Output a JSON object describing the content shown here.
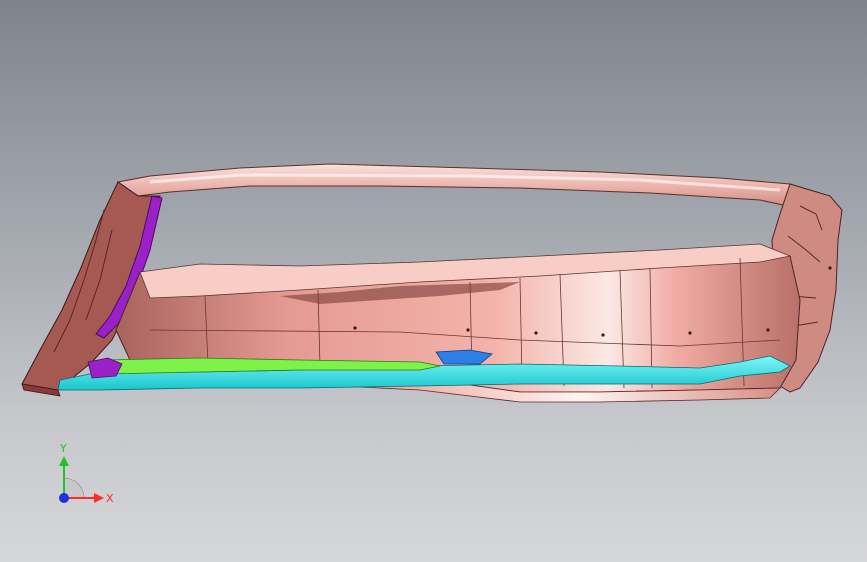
{
  "triad": {
    "x_label": "X",
    "y_label": "Y",
    "x_color": "#ff2a2a",
    "y_color": "#22c22a",
    "z_color": "#2030e0"
  },
  "colors": {
    "background_top": "#7f848c",
    "background_bottom": "#d6d7d9",
    "body_shell": "#e8a49c",
    "body_highlight": "#fbe6e2",
    "body_shadow": "#b06a64",
    "edge_lines": "#3a2020",
    "bracket_purple": "#9a20c8",
    "trim_cyan": "#28e0e6",
    "trim_green": "#7cf24a",
    "clip_blue": "#2f7ee8"
  }
}
